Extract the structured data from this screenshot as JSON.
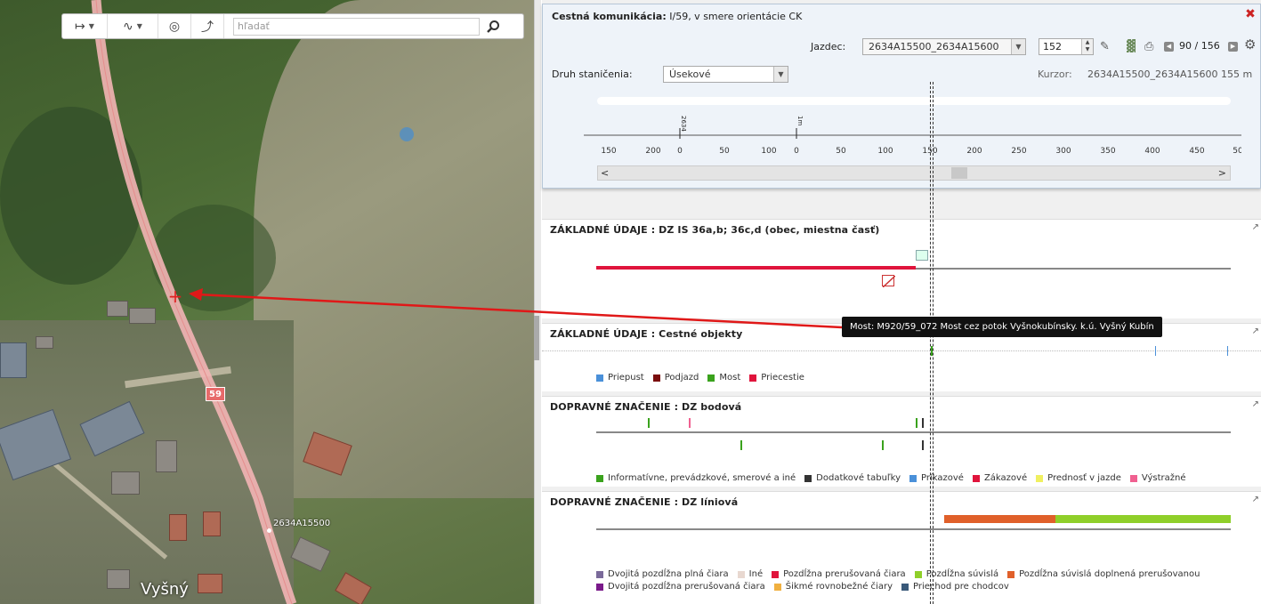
{
  "toolbar": {
    "search_placeholder": "hľadať",
    "measure_icon": "measure-distance-icon",
    "route_icon": "route-icon",
    "compass_icon": "compass-icon",
    "turn_icon": "turn-arrow-icon",
    "search_icon": "magnifier-icon"
  },
  "map": {
    "route_number": "59",
    "segment_label": "2634A15500",
    "place_name": "Vyšný",
    "road_marks": [
      "3",
      "3",
      "2",
      "1",
      "0",
      "5",
      "3",
      "10"
    ]
  },
  "header": {
    "title_bold": "Cestná komunikácia:",
    "title_rest": " I/59, v smere orientácie CK",
    "jazdec_label": "Jazdec:",
    "jazdec_value": "2634A15500_2634A15600",
    "spinner_value": "152",
    "page_info": "90 / 156",
    "druh_label": "Druh staničenia:",
    "druh_value": "Úsekové",
    "kurzor_label": "Kurzor:",
    "kurzor_value": "2634A15500_2634A15600 155 m",
    "axis_ticks": [
      "150",
      "200",
      "0",
      "50",
      "100",
      "0",
      "50",
      "100",
      "150",
      "200",
      "250",
      "300",
      "350",
      "400",
      "450",
      "50"
    ],
    "axis_markers": [
      "2634",
      "1m"
    ],
    "scroll_left": "<",
    "scroll_right": ">"
  },
  "sections": {
    "basic_dz": {
      "title": "ZÁKLADNÉ ÚDAJE : DZ IS 36a,b; 36c,d (obec, miestna časť)"
    },
    "objects": {
      "title": "ZÁKLADNÉ ÚDAJE : Cestné objekty",
      "legend": [
        {
          "label": "Priepust",
          "color": "#4a90d9"
        },
        {
          "label": "Podjazd",
          "color": "#7a0e0e"
        },
        {
          "label": "Most",
          "color": "#3aa21d"
        },
        {
          "label": "Priecestie",
          "color": "#e0143c"
        }
      ]
    },
    "dz_point": {
      "title": "DOPRAVNÉ ZNAČENIE : DZ bodová",
      "legend": [
        {
          "label": "Informatívne, prevádzkové, smerové a iné",
          "color": "#3aa21d"
        },
        {
          "label": "Dodatkové tabuľky",
          "color": "#333333"
        },
        {
          "label": "Príkazové",
          "color": "#4a90d9"
        },
        {
          "label": "Zákazové",
          "color": "#e0143c"
        },
        {
          "label": "Prednosť v jazde",
          "color": "#f0f060"
        },
        {
          "label": "Výstražné",
          "color": "#f06090"
        }
      ]
    },
    "dz_line": {
      "title": "DOPRAVNÉ ZNAČENIE : DZ líniová",
      "legend": [
        {
          "label": "Dvojitá pozdĺžna plná čiara",
          "color": "#7a6a9a"
        },
        {
          "label": "Iné",
          "color": "#e8d8d0"
        },
        {
          "label": "Pozdĺžna prerušovaná čiara",
          "color": "#e0143c"
        },
        {
          "label": "Pozdĺžna súvislá",
          "color": "#8fcf2a"
        },
        {
          "label": "Pozdĺžna súvislá doplnená prerušovanou",
          "color": "#e0602a"
        },
        {
          "label": "Dvojitá pozdĺžna prerušovaná čiara",
          "color": "#7a1a8a"
        },
        {
          "label": "Šikmé rovnobežné čiary",
          "color": "#f0b040"
        },
        {
          "label": "Priechod pre chodcov",
          "color": "#3a5a7a"
        }
      ]
    }
  },
  "tooltip": "Most: M920/59_072 Most cez potok Vyšnokubínsky. k.ú. Vyšný Kubín",
  "colors": {
    "accent_red": "#e0143c",
    "header_bg": "#eef3f9",
    "line_green": "#8fcf2a",
    "line_orange": "#e0602a"
  }
}
